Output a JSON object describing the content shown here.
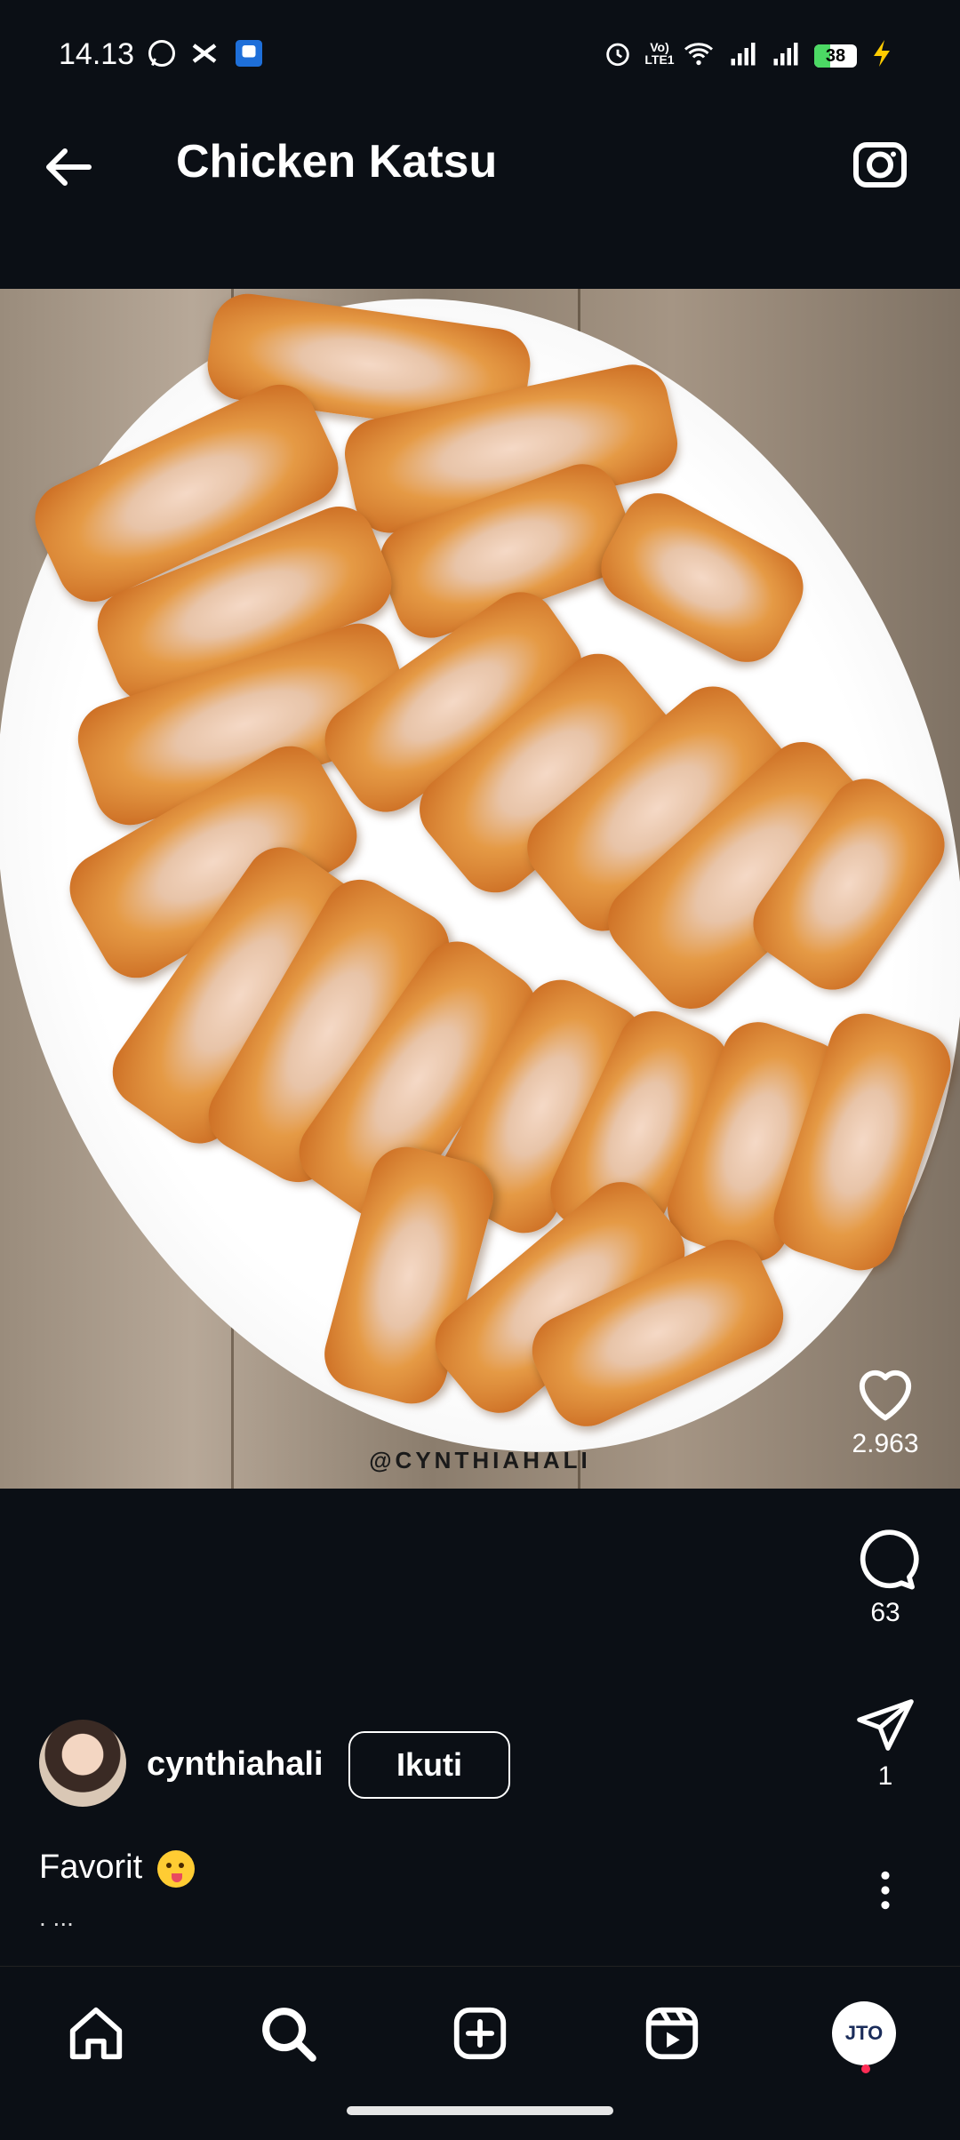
{
  "status_bar": {
    "time": "14.13",
    "network_label": "Vo) LTE1",
    "battery": "38",
    "battery_level": 0.38
  },
  "header": {
    "title": "Chicken Katsu"
  },
  "post": {
    "watermark": "@CYNTHIAHALI",
    "likes": "2.963",
    "comments": "63",
    "shares": "1"
  },
  "author": {
    "username": "cynthiahali",
    "follow_label": "Ikuti"
  },
  "caption": {
    "text": "Favorit",
    "more": ". ..."
  },
  "nav": {
    "items": [
      "home-icon",
      "search-icon",
      "create-post-icon",
      "reels-icon",
      "profile-avatar"
    ],
    "profile_label": "JTO"
  },
  "colors": {
    "background": "#0b0f15",
    "notification_dot": "#ff2d55"
  }
}
